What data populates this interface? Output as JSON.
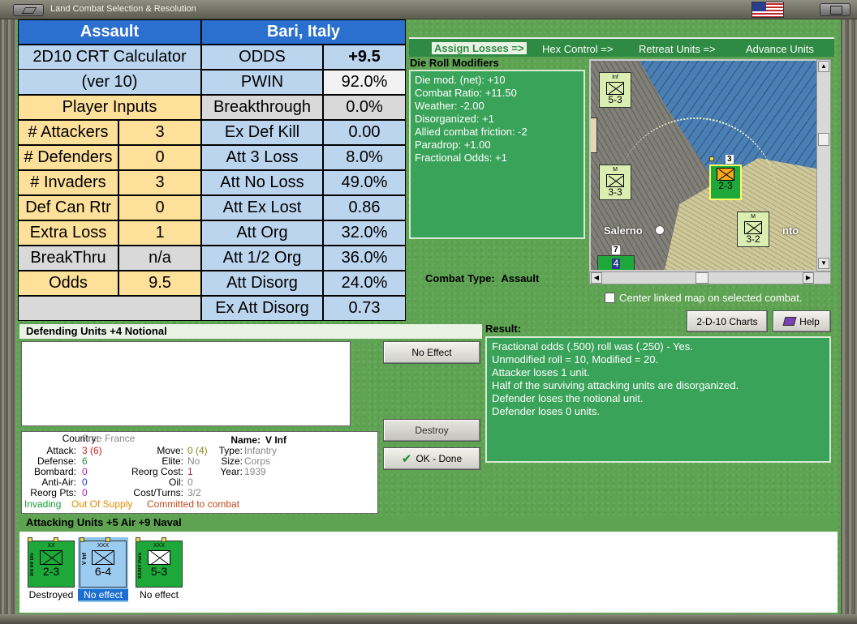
{
  "window": {
    "title": "Land Combat Selection & Resolution"
  },
  "tabs": [
    "Assign Losses =>",
    "Hex Control =>",
    "Retreat Units =>",
    "Advance Units"
  ],
  "calc": {
    "title_left": "Assault",
    "title_right": "Bari, Italy",
    "calc_name": "2D10 CRT Calculator",
    "version": "(ver 10)",
    "player_inputs": "Player Inputs",
    "inputs": [
      {
        "label": "# Attackers",
        "value": "3"
      },
      {
        "label": "# Defenders",
        "value": "0"
      },
      {
        "label": "# Invaders",
        "value": "3"
      },
      {
        "label": "Def Can Rtr",
        "value": "0"
      },
      {
        "label": "Extra Loss",
        "value": "1"
      },
      {
        "label": "BreakThru",
        "value": "n/a"
      },
      {
        "label": "Odds",
        "value": "9.5"
      }
    ],
    "results": [
      {
        "label": "ODDS",
        "value": "+9.5"
      },
      {
        "label": "PWIN",
        "value": "92.0%"
      },
      {
        "label": "Breakthrough",
        "value": "0.0%"
      },
      {
        "label": "Ex Def Kill",
        "value": "0.00"
      },
      {
        "label": "Att 3 Loss",
        "value": "8.0%"
      },
      {
        "label": "Att No Loss",
        "value": "49.0%"
      },
      {
        "label": "Att Ex Lost",
        "value": "0.86"
      },
      {
        "label": "Att Org",
        "value": "32.0%"
      },
      {
        "label": "Att 1/2 Org",
        "value": "36.0%"
      },
      {
        "label": "Att Disorg",
        "value": "24.0%"
      },
      {
        "label": "Ex Att Disorg",
        "value": "0.73"
      }
    ]
  },
  "die_roll": {
    "label": "Die Roll Modifiers",
    "lines": [
      "Die mod. (net): +10",
      "",
      "Combat Ratio: +11.50",
      "Weather: -2.00",
      "Disorganized: +1",
      "Allied combat friction: -2",
      "Paradrop: +1.00",
      "Fractional Odds: +1"
    ]
  },
  "map": {
    "city": "Salerno",
    "partial_city": "nto",
    "counters": [
      {
        "size": "Inf",
        "str": "5-3"
      },
      {
        "size": "",
        "str": "3"
      },
      {
        "size": "M",
        "str": "3-3"
      },
      {
        "size": "",
        "str": "2-3"
      },
      {
        "size": "M",
        "str": "3-2"
      },
      {
        "size": "",
        "str": "4"
      }
    ],
    "stack_counts": [
      "3",
      "7"
    ]
  },
  "combat_type": {
    "label": "Combat Type:",
    "value": "Assault"
  },
  "center_checkbox": {
    "label": "Center linked map on selected combat."
  },
  "buttons": {
    "charts": "2-D-10 Charts",
    "help": "Help",
    "no_effect": "No Effect",
    "destroy": "Destroy",
    "ok_done": "OK - Done"
  },
  "defending": {
    "label": "Defending Units +4 Notional"
  },
  "result": {
    "label": "Result:",
    "lines": [
      "Fractional odds (.500) roll was (.250)  - Yes.",
      "Unmodified roll = 10, Modified = 20.",
      "Attacker loses 1 unit.",
      "Half of the surviving attacking units are disorganized.",
      "Defender loses the notional unit.",
      "Defender loses 0 units."
    ]
  },
  "unit_info": {
    "country_label": "Country:",
    "country": "Free France",
    "name_label": "Name:",
    "name": "V Inf",
    "attack_label": "Attack:",
    "attack": "3",
    "attack_paren": "(6)",
    "move_label": "Move:",
    "move": "0",
    "move_paren": "(4)",
    "type_label": "Type:",
    "type": "Infantry",
    "defense_label": "Defense:",
    "defense": "6",
    "elite_label": "Elite:",
    "elite": "No",
    "size_label": "Size:",
    "size": "Corps",
    "bombard_label": "Bombard:",
    "bombard": "0",
    "reorg_cost_label": "Reorg Cost:",
    "reorg_cost": "1",
    "year_label": "Year:",
    "year": "1939",
    "antiair_label": "Anti-Air:",
    "antiair": "0",
    "oil_label": "Oil:",
    "oil": "0",
    "reorg_pts_label": "Reorg Pts:",
    "reorg_pts": "0",
    "cost_turns_label": "Cost/Turns:",
    "cost_turns": "3/2",
    "status_invading": "Invading",
    "status_supply": "Out Of Supply",
    "status_committed": "Committed to combat"
  },
  "attacking": {
    "label": "Attacking Units +5 Air +9 Naval",
    "units": [
      {
        "size": "XX",
        "side_label": "3rd Inf Div",
        "str": "2-3",
        "caption": "Destroyed"
      },
      {
        "size": "XXX",
        "side_label": "V Inf",
        "str": "6-4",
        "caption": "No effect"
      },
      {
        "size": "XXX",
        "side_label": "XXXIV Para",
        "str": "5-3",
        "caption": "No effect"
      }
    ]
  },
  "colors": {
    "accent_blue": "#2b6fcf",
    "panel_green": "#3aa35a",
    "bg_green": "#5ea352",
    "peach": "#fde09a",
    "light_blue": "#bcd5ee"
  }
}
